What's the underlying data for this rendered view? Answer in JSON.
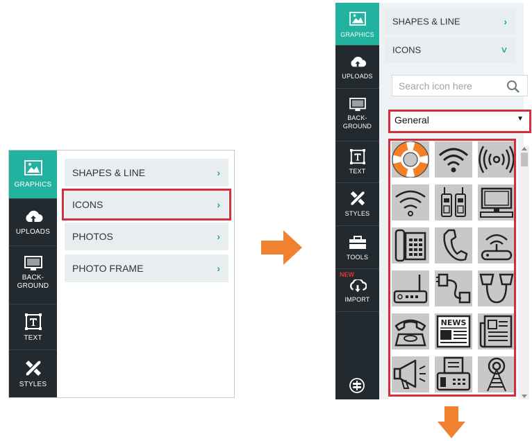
{
  "left_panel": {
    "sidebar": [
      {
        "label": "GRAPHICS",
        "icon": "image-icon",
        "active": true
      },
      {
        "label": "UPLOADS",
        "icon": "cloud-upload-icon"
      },
      {
        "label": "BACK-\nGROUND",
        "icon": "monitor-icon"
      },
      {
        "label": "TEXT",
        "icon": "text-icon"
      },
      {
        "label": "STYLES",
        "icon": "pencil-ruler-icon"
      }
    ],
    "menu": [
      {
        "label": "SHAPES & LINE",
        "chevron": "›"
      },
      {
        "label": "ICONS",
        "chevron": "›",
        "highlighted": true
      },
      {
        "label": "PHOTOS",
        "chevron": "›"
      },
      {
        "label": "PHOTO FRAME",
        "chevron": "›"
      }
    ]
  },
  "right_panel": {
    "sidebar": [
      {
        "label": "GRAPHICS",
        "icon": "image-icon",
        "active": true
      },
      {
        "label": "UPLOADS",
        "icon": "cloud-upload-icon"
      },
      {
        "label": "BACK-\nGROUND",
        "icon": "monitor-icon"
      },
      {
        "label": "TEXT",
        "icon": "text-icon"
      },
      {
        "label": "STYLES",
        "icon": "pencil-ruler-icon"
      },
      {
        "label": "TOOLS",
        "icon": "toolbox-icon"
      },
      {
        "label": "IMPORT",
        "icon": "cloud-download-icon",
        "badge": "NEW"
      }
    ],
    "bottom_icon": "signpost-icon",
    "shapes_label": "SHAPES & LINE",
    "shapes_chevron": "›",
    "icons_label": "ICONS",
    "icons_chevron": "˅",
    "search": {
      "placeholder": "Search icon here",
      "icon": "search-icon"
    },
    "category": {
      "value": "General",
      "arrow": "▼"
    },
    "icons": [
      "lifebuoy-icon",
      "wifi-icon",
      "broadcast-icon",
      "wifi-signal-icon",
      "walkie-talkie-icon",
      "computer-icon",
      "phone-keypad-icon",
      "handset-icon",
      "router-icon",
      "modem-icon",
      "cable-icon",
      "cups-icon",
      "rotary-phone-icon",
      "newspaper-icon",
      "document-icon",
      "megaphone-icon",
      "fax-icon",
      "antenna-icon"
    ],
    "news_text": "NEWS"
  },
  "colors": {
    "accent": "#22b3a0",
    "sidebar_bg": "#222a2f",
    "highlight": "#d32f3a",
    "arrow": "#f0822f"
  }
}
